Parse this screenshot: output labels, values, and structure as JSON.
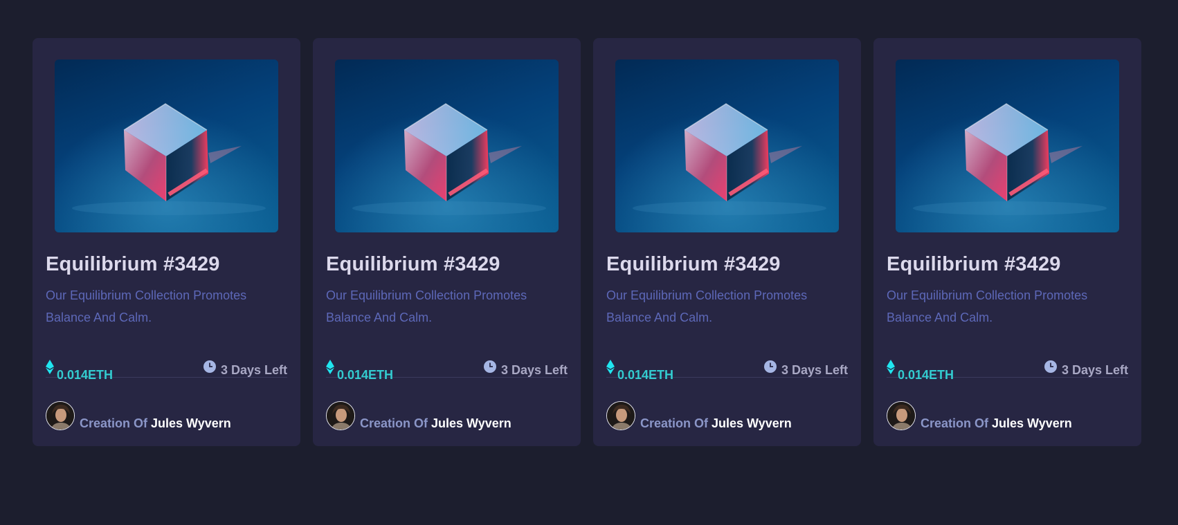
{
  "cards": [
    {
      "title": "Equilibrium #3429",
      "description": "Our Equilibrium Collection Promotes Balance And Calm.",
      "price": "0.014ETH",
      "time_left": "3 Days Left",
      "creator_prefix": "Creation Of",
      "creator_name": "Jules Wyvern",
      "price_icon": "ethereum-icon",
      "time_icon": "clock-icon"
    },
    {
      "title": "Equilibrium #3429",
      "description": "Our Equilibrium Collection Promotes Balance And Calm.",
      "price": "0.014ETH",
      "time_left": "3 Days Left",
      "creator_prefix": "Creation Of",
      "creator_name": "Jules Wyvern",
      "price_icon": "ethereum-icon",
      "time_icon": "clock-icon"
    },
    {
      "title": "Equilibrium #3429",
      "description": "Our Equilibrium Collection Promotes Balance And Calm.",
      "price": "0.014ETH",
      "time_left": "3 Days Left",
      "creator_prefix": "Creation Of",
      "creator_name": "Jules Wyvern",
      "price_icon": "ethereum-icon",
      "time_icon": "clock-icon"
    },
    {
      "title": "Equilibrium #3429",
      "description": "Our Equilibrium Collection Promotes Balance And Calm.",
      "price": "0.014ETH",
      "time_left": "3 Days Left",
      "creator_prefix": "Creation Of",
      "creator_name": "Jules Wyvern",
      "price_icon": "ethereum-icon",
      "time_icon": "clock-icon"
    }
  ],
  "colors": {
    "page_background": "#1c1e2e",
    "card_background": "#272643",
    "price_accent": "#33ccd0",
    "description": "#5d68b8",
    "title": "#dcd9ec"
  }
}
